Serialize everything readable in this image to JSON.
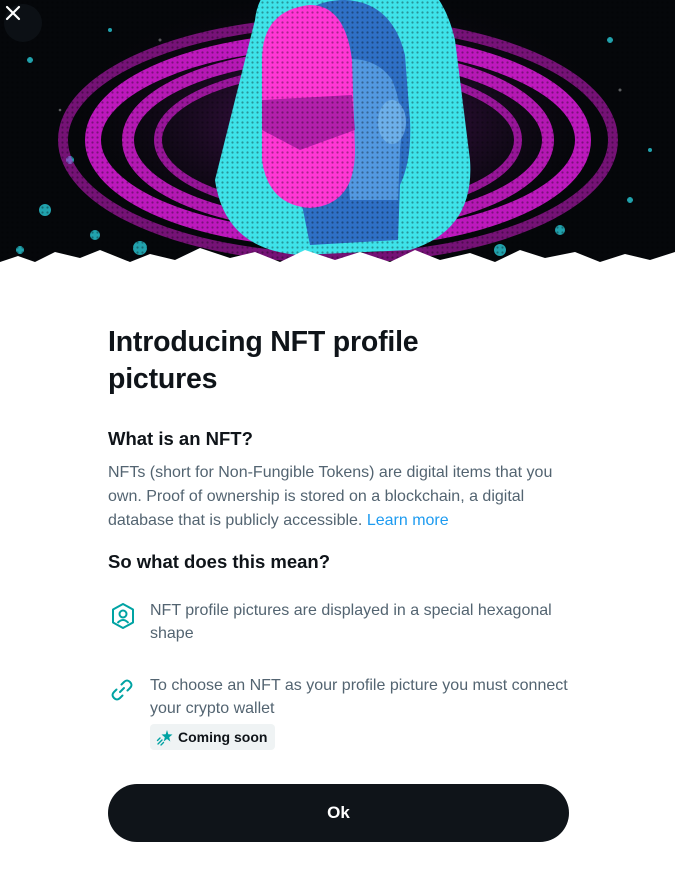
{
  "modal": {
    "title": "Introducing NFT profile pictures",
    "section1": {
      "heading": "What is an NFT?",
      "body": "NFTs (short for Non-Fungible Tokens) are digital items that you own. Proof of ownership is stored on a blockchain, a digital database that is publicly accessible.",
      "link": "Learn more"
    },
    "section2": {
      "heading": "So what does this mean?",
      "features": [
        {
          "icon": "hexagon-profile-icon",
          "text": "NFT profile pictures are displayed in a special hexagonal shape"
        },
        {
          "icon": "link-icon",
          "text": "To choose an NFT as your profile picture you must connect your crypto wallet"
        }
      ],
      "badge": {
        "icon": "sparkle-star-icon",
        "label": "Coming soon"
      }
    },
    "ok_label": "Ok"
  },
  "colors": {
    "accent_link": "#1d9bf0",
    "accent_teal": "#00a3a3",
    "button_bg": "#0f1419",
    "hero_magenta": "#e81fd1",
    "hero_cyan": "#3ee3ea"
  },
  "icons": {
    "close": "close-icon"
  }
}
